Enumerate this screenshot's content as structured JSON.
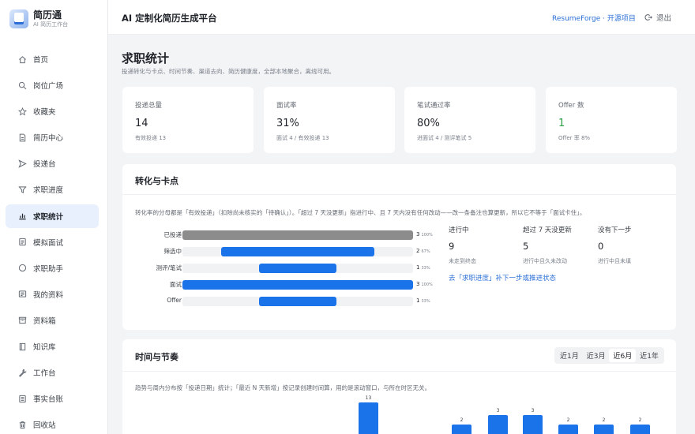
{
  "brand": {
    "name": "简历通",
    "sub": "AI 简历工作台"
  },
  "nav": [
    {
      "label": "首页",
      "icon": "home-icon",
      "active": false
    },
    {
      "label": "岗位广场",
      "icon": "search-icon",
      "active": false
    },
    {
      "label": "收藏夹",
      "icon": "star-icon",
      "active": false
    },
    {
      "label": "简历中心",
      "icon": "document-icon",
      "active": false
    },
    {
      "label": "投递台",
      "icon": "send-icon",
      "active": false
    },
    {
      "label": "求职进度",
      "icon": "funnel-icon",
      "active": false
    },
    {
      "label": "求职统计",
      "icon": "bar-chart-icon",
      "active": true
    },
    {
      "label": "模拟面试",
      "icon": "interview-icon",
      "active": false
    },
    {
      "label": "求职助手",
      "icon": "chat-icon",
      "active": false
    },
    {
      "label": "我的资料",
      "icon": "profile-icon",
      "active": false
    },
    {
      "label": "资料箱",
      "icon": "box-icon",
      "active": false
    },
    {
      "label": "知识库",
      "icon": "book-icon",
      "active": false
    },
    {
      "label": "工作台",
      "icon": "tool-icon",
      "active": false
    },
    {
      "label": "事实台账",
      "icon": "ledger-icon",
      "active": false
    },
    {
      "label": "回收站",
      "icon": "trash-icon",
      "active": false
    }
  ],
  "header": {
    "title": "AI 定制化简历生成平台",
    "link": "ResumeForge · 开源项目",
    "logout": "退出"
  },
  "page": {
    "title": "求职统计",
    "subtitle": "投递转化与卡点、时间节奏、渠道去向、简历健康度，全部本地聚合，离线可用。"
  },
  "stats": [
    {
      "label": "投递总量",
      "value": "14",
      "note": "有效投递 13",
      "color": "#1f2329"
    },
    {
      "label": "面试率",
      "value": "31%",
      "note": "面试 4 / 有效投递 13",
      "color": "#1f2329"
    },
    {
      "label": "笔试通过率",
      "value": "80%",
      "note": "进面试 4 / 测评笔试 5",
      "color": "#1f2329"
    },
    {
      "label": "Offer 数",
      "value": "1",
      "note": "Offer 率 8%",
      "color": "#2a9d44"
    }
  ],
  "funnel_panel": {
    "title": "转化与卡点",
    "desc": "转化率的分母都是「有效投递」（扣除尚未核实的「待确认」）。「超过 7 天没更新」指进行中、且 7 天内没有任何改动——改一条备注也算更新，所以它不等于「面试卡住」。",
    "rows": [
      {
        "label": "已投递",
        "count": "3",
        "pct": "100%",
        "fraction": 1.0,
        "offset": 0.0,
        "style": "gray"
      },
      {
        "label": "筛选中",
        "count": "2",
        "pct": "67%",
        "fraction": 0.667,
        "offset": 0.1665,
        "style": "blue"
      },
      {
        "label": "测评/笔试",
        "count": "1",
        "pct": "33%",
        "fraction": 0.333,
        "offset": 0.3335,
        "style": "blue"
      },
      {
        "label": "面试",
        "count": "3",
        "pct": "100%",
        "fraction": 1.0,
        "offset": 0.0,
        "style": "blue"
      },
      {
        "label": "Offer",
        "count": "1",
        "pct": "33%",
        "fraction": 0.333,
        "offset": 0.3335,
        "style": "blue"
      }
    ],
    "side": [
      {
        "label": "进行中",
        "value": "9",
        "note": "未走到终态"
      },
      {
        "label": "超过 7 天没更新",
        "value": "5",
        "note": "进行中且久未改动"
      },
      {
        "label": "没有下一步",
        "value": "0",
        "note": "进行中且未填"
      }
    ],
    "link": "去「求职进度」补下一步或推进状态"
  },
  "time_panel": {
    "title": "时间与节奏",
    "ranges": [
      "近1月",
      "近3月",
      "近6月",
      "近1年"
    ],
    "selected_range": "近6月",
    "desc": "趋势与周内分布按「投递日期」统计；「最近 N 天新增」按记录创建时间算，用的是滚动窗口，与所在时区无关。"
  },
  "chart_data": {
    "type": "bar",
    "series": [
      {
        "values": [
          13,
          2,
          3,
          3,
          2,
          2,
          2
        ]
      }
    ]
  }
}
